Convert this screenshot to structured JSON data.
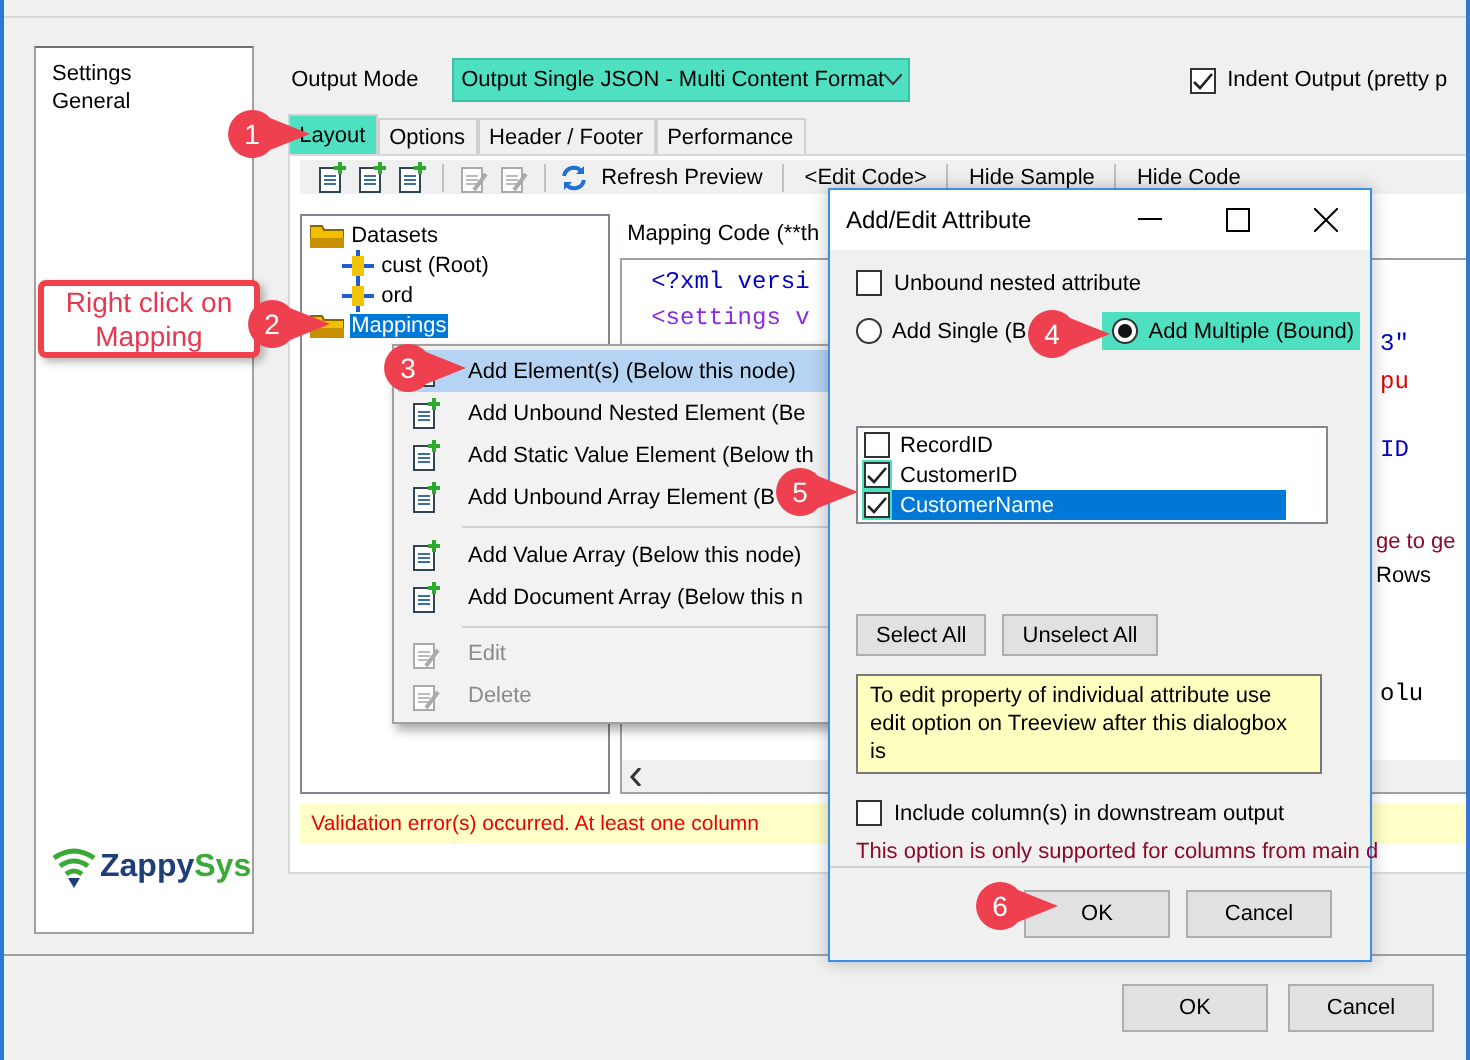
{
  "sidebar": {
    "items": [
      {
        "label": "Settings"
      },
      {
        "label": "General"
      }
    ],
    "logo": {
      "first": "Zappy",
      "second": "Sys"
    }
  },
  "output_mode": {
    "label": "Output Mode",
    "value": "Output Single JSON - Multi Content Format"
  },
  "indent_output": {
    "label": "Indent Output (pretty p",
    "checked": true
  },
  "tabs": [
    {
      "label": "Layout",
      "selected": true
    },
    {
      "label": "Options",
      "selected": false
    },
    {
      "label": "Header / Footer",
      "selected": false
    },
    {
      "label": "Performance",
      "selected": false
    }
  ],
  "toolbar": {
    "refresh": "Refresh Preview",
    "links": [
      "<Edit Code>",
      "Hide Sample",
      "Hide Code"
    ]
  },
  "tree": [
    {
      "label": "Datasets",
      "kind": "folder",
      "selected": false,
      "children": [
        {
          "label": "cust (Root)",
          "kind": "dataset",
          "selected": false
        },
        {
          "label": "ord",
          "kind": "dataset",
          "selected": false
        }
      ]
    },
    {
      "label": "Mappings",
      "kind": "folder",
      "selected": true
    }
  ],
  "mapping_code": {
    "label": "Mapping Code (**th",
    "lines": [
      "<?xml versi",
      "<settings v"
    ]
  },
  "code_fragments": [
    {
      "text": "3\"",
      "kind": "code"
    },
    {
      "text": "pu",
      "kind": "code"
    },
    {
      "text": "ID",
      "kind": "code"
    },
    {
      "text": "ge to ge",
      "kind": "label"
    },
    {
      "text": "Rows",
      "kind": "label"
    },
    {
      "text": "olu",
      "kind": "code"
    }
  ],
  "validation": "Validation error(s) occurred. At least one column",
  "context_menu": [
    {
      "label": "Add Element(s) (Below this node)",
      "kind": "element",
      "highlighted": true,
      "disabled": false
    },
    {
      "label": "Add Unbound Nested Element (Be",
      "kind": "element",
      "highlighted": false,
      "disabled": false
    },
    {
      "label": "Add Static Value Element (Below th",
      "kind": "element",
      "highlighted": false,
      "disabled": false
    },
    {
      "label": "Add Unbound Array Element (B",
      "kind": "element",
      "highlighted": false,
      "disabled": false
    },
    {
      "kind": "separator"
    },
    {
      "label": "Add Value Array (Below this node)",
      "kind": "array",
      "highlighted": false,
      "disabled": false
    },
    {
      "label": "Add Document Array (Below this n",
      "kind": "array",
      "highlighted": false,
      "disabled": false
    },
    {
      "kind": "separator"
    },
    {
      "label": "Edit",
      "kind": "edit",
      "highlighted": false,
      "disabled": true
    },
    {
      "label": "Delete",
      "kind": "delete",
      "highlighted": false,
      "disabled": true
    }
  ],
  "dialog": {
    "title": "Add/Edit Attribute",
    "unbound": {
      "label": "Unbound nested attribute",
      "checked": false
    },
    "radios": [
      {
        "label": "Add Single (B",
        "selected": false
      },
      {
        "label": "Add Multiple (Bound)",
        "selected": true
      }
    ],
    "columns": [
      {
        "label": "RecordID",
        "checked": false,
        "selected": false
      },
      {
        "label": "CustomerID",
        "checked": true,
        "selected": false
      },
      {
        "label": "CustomerName",
        "checked": true,
        "selected": true
      }
    ],
    "select_buttons": [
      "Select All",
      "Unselect All"
    ],
    "note": "To edit property of individual attribute use edit option on Treeview after this dialogbox is",
    "include": {
      "label": "Include column(s) in downstream output",
      "checked": false
    },
    "include_note": "This option is only supported for columns from main d",
    "buttons": [
      "OK",
      "Cancel"
    ]
  },
  "annotation": "Right click on Mapping",
  "callouts": [
    {
      "number": "1"
    },
    {
      "number": "2"
    },
    {
      "number": "3"
    },
    {
      "number": "4"
    },
    {
      "number": "5"
    },
    {
      "number": "6"
    }
  ],
  "footer_buttons": [
    "OK",
    "Cancel"
  ]
}
